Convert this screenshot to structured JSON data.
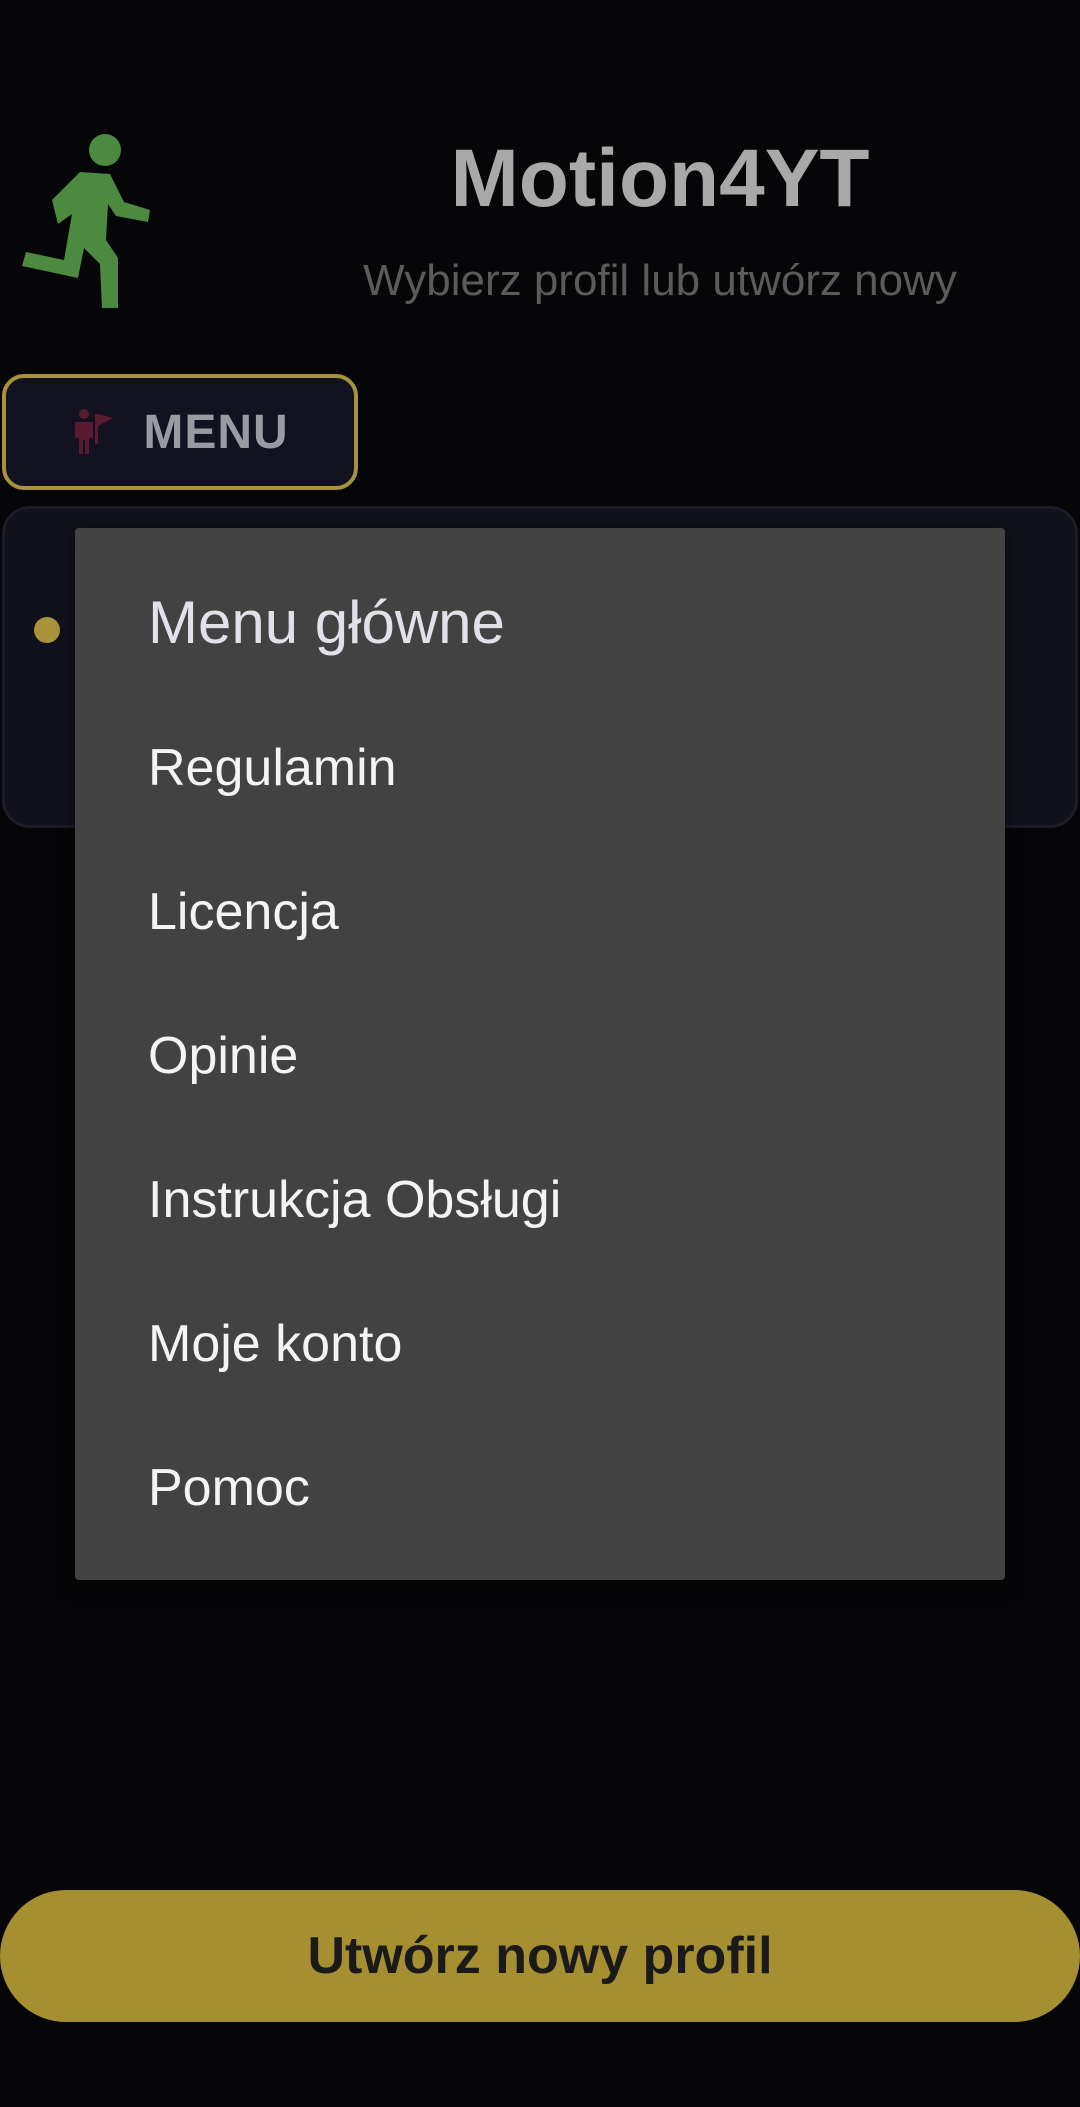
{
  "header": {
    "title": "Motion4YT",
    "subtitle": "Wybierz profil lub utwórz nowy",
    "logo_icon": "running-person-icon"
  },
  "menu_button": {
    "label": "MENU",
    "icon": "person-flag-icon"
  },
  "dropdown": {
    "title": "Menu główne",
    "items": [
      {
        "label": "Regulamin"
      },
      {
        "label": "Licencja"
      },
      {
        "label": "Opinie"
      },
      {
        "label": "Instrukcja Obsługi"
      },
      {
        "label": "Moje konto"
      },
      {
        "label": "Pomoc"
      }
    ]
  },
  "create_button": {
    "label": "Utwórz nowy profil"
  },
  "colors": {
    "background": "#060608",
    "accent_gold": "#a68f31",
    "logo_green": "#4c8a3f",
    "dropdown_bg": "#424242",
    "menu_icon_maroon": "#5a1a30"
  }
}
